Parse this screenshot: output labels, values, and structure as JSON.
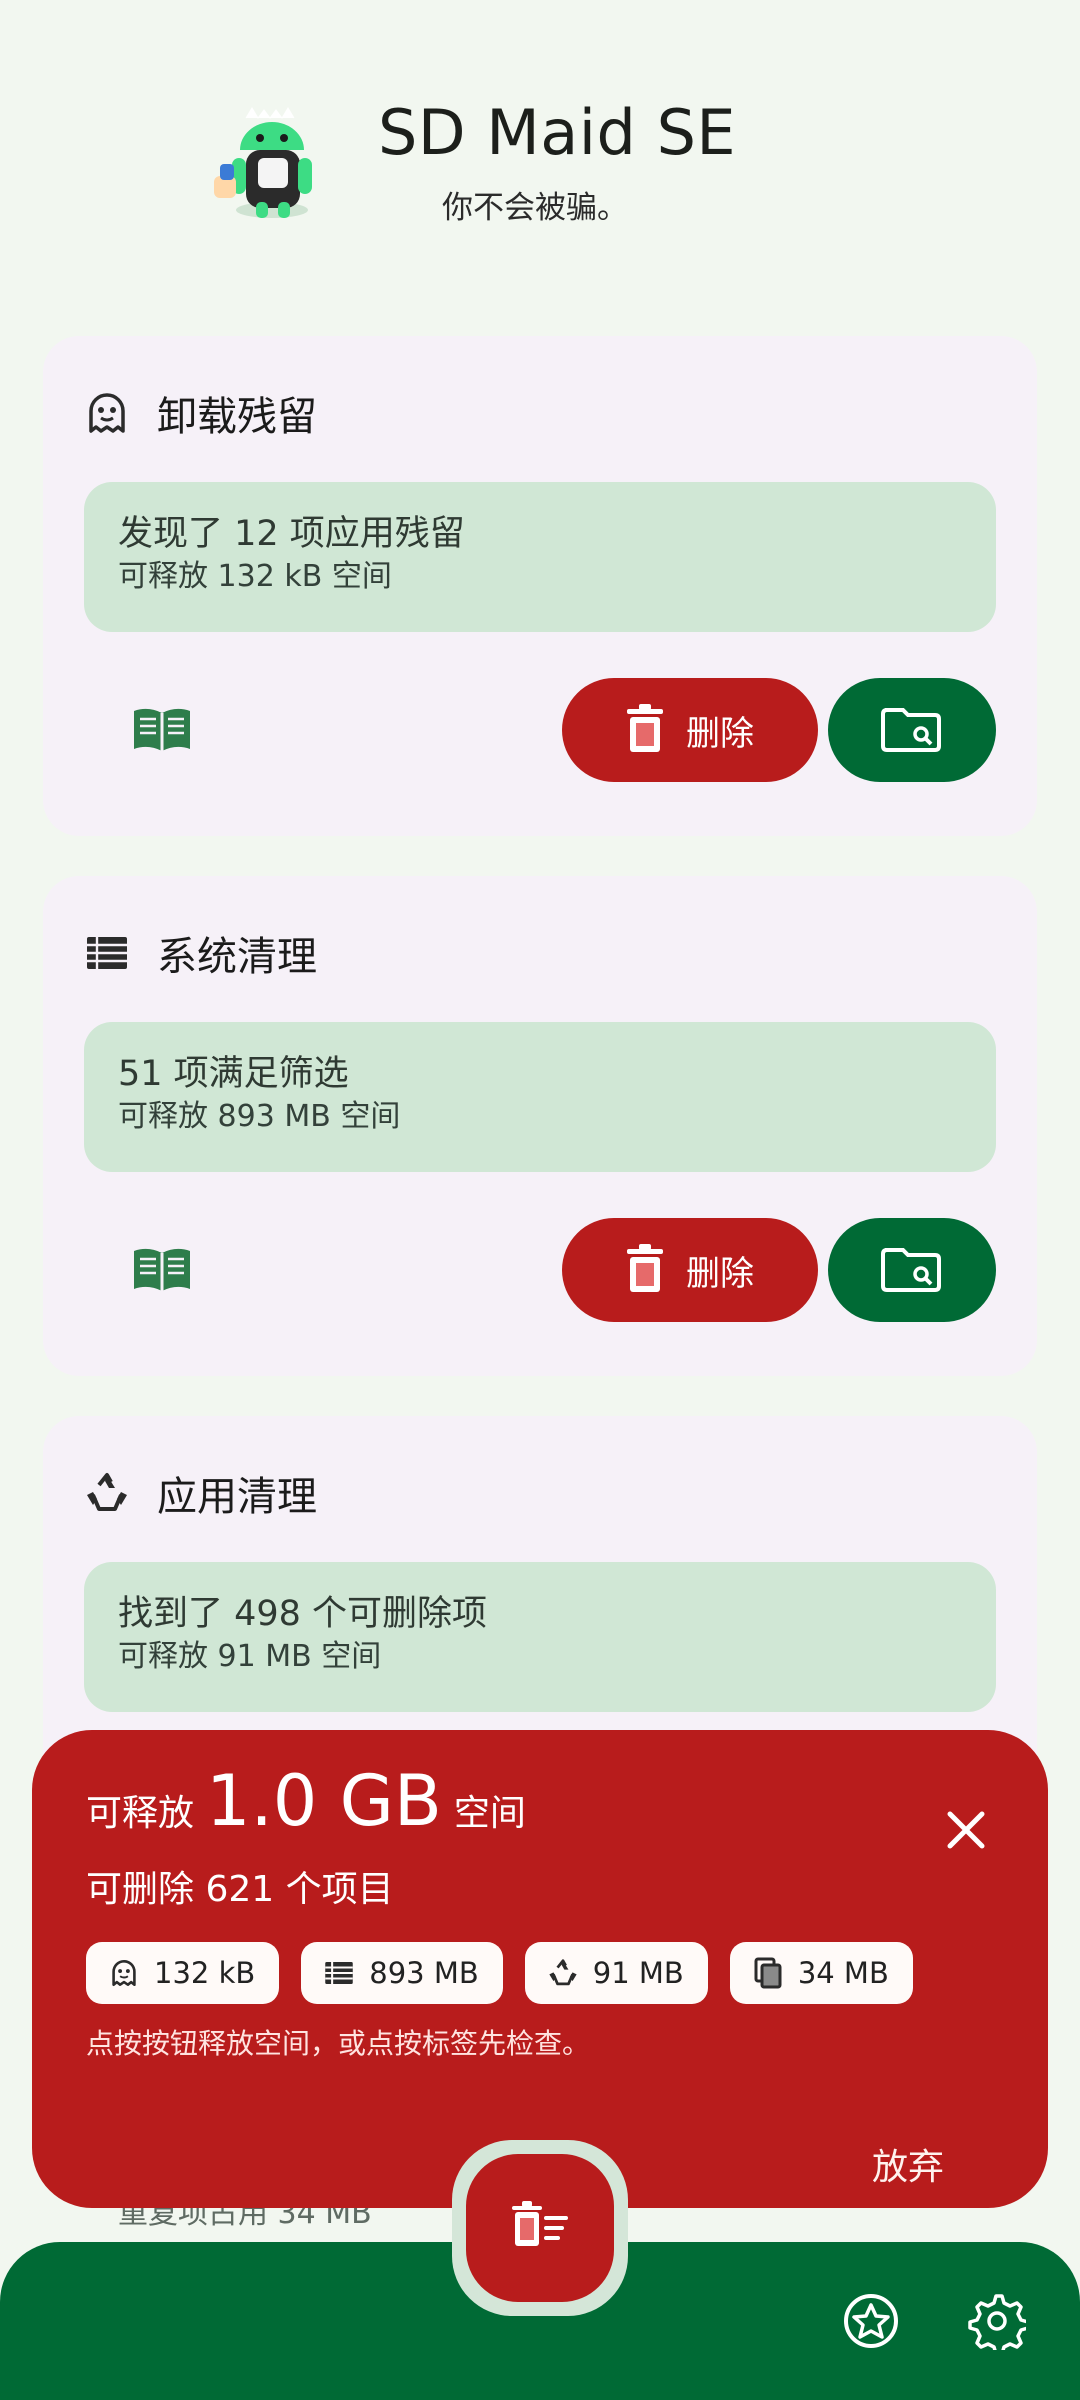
{
  "header": {
    "app_title": "SD Maid SE",
    "subtitle": "你不会被骗。",
    "logo_icon": "sd-maid-robot-logo"
  },
  "cards": [
    {
      "title": "卸载残留",
      "icon": "ghost-icon",
      "info_line1": "发现了 12 项应用残留",
      "info_line2": "可释放 132 kB 空间",
      "delete_label": "删除"
    },
    {
      "title": "系统清理",
      "icon": "list-icon",
      "info_line1": "51 项满足筛选",
      "info_line2": "可释放 893 MB 空间",
      "delete_label": "删除"
    },
    {
      "title": "应用清理",
      "icon": "recycle-icon",
      "info_line1": "找到了 498 个可删除项",
      "info_line2": "可释放 91 MB 空间"
    }
  ],
  "peek_text": "重复项占用 34 MB",
  "sheet": {
    "prefix": "可释放",
    "amount": "1.0 GB",
    "suffix": "空间",
    "subtitle": "可删除 621 个项目",
    "chips": [
      {
        "icon": "ghost-icon",
        "label": "132 kB"
      },
      {
        "icon": "list-icon",
        "label": "893 MB"
      },
      {
        "icon": "recycle-icon",
        "label": "91 MB"
      },
      {
        "icon": "duplicate-icon",
        "label": "34 MB"
      }
    ],
    "hint": "点按按钮释放空间，或点按标签先检查。",
    "dismiss_label": "放弃"
  },
  "colors": {
    "background": "#f2f7f0",
    "card": "#f6f1f8",
    "info_box": "#d0e7d5",
    "danger": "#b81c1c",
    "primary": "#006a35"
  }
}
